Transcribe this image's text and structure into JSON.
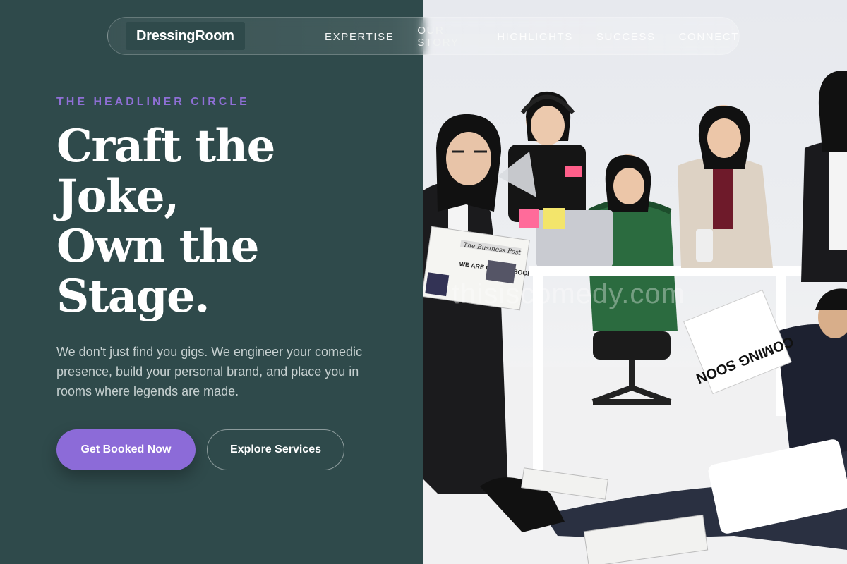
{
  "brand": {
    "name": "DressingRoom"
  },
  "nav": {
    "links": [
      "EXPERTISE",
      "OUR STORY",
      "HIGHLIGHTS",
      "SUCCESS",
      "CONNECT"
    ]
  },
  "hero": {
    "eyebrow": "THE HEADLINER CIRCLE",
    "headline_lines": [
      "Craft the",
      "Joke,",
      "Own the",
      "Stage."
    ],
    "lede": "We don't just find you gigs. We engineer your comedic presence, build your personal brand, and place you in rooms where legends are made.",
    "primary_cta": "Get Booked Now",
    "secondary_cta": "Explore Services"
  },
  "photo": {
    "sign_text": "COMING SOON",
    "newspaper_masthead": "The Business Post",
    "newspaper_headline": "WE ARE COMING SOON",
    "watermark": "thisiscomedy.com"
  },
  "colors": {
    "background": "#2f4a4b",
    "accent": "#8c6bd8",
    "eyebrow": "#8f6fd6"
  }
}
